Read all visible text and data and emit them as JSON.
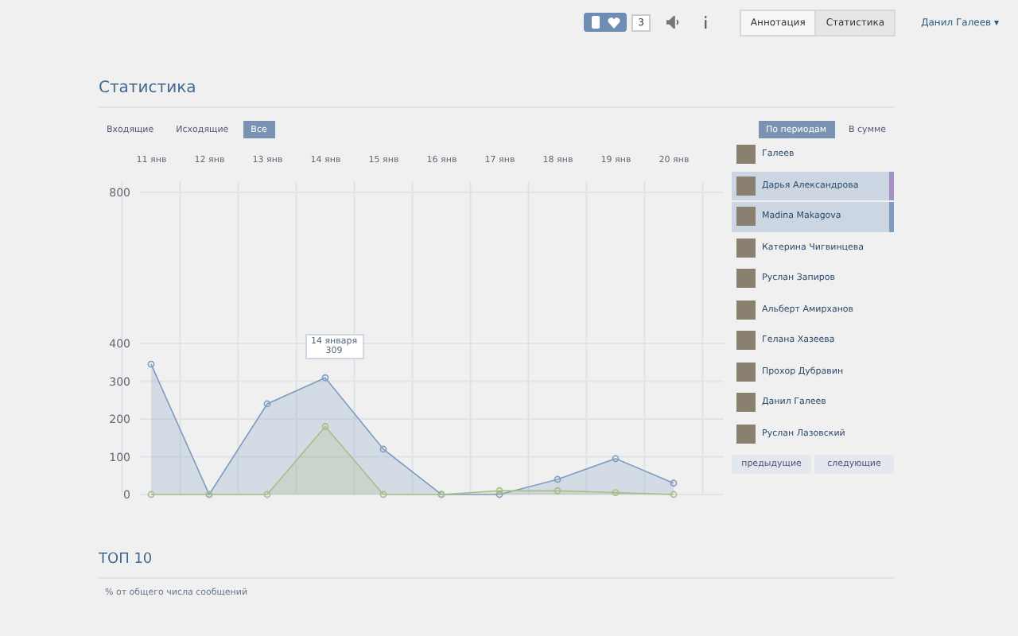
{
  "topbar": {
    "badge_count": "3",
    "tabs": [
      {
        "label": "Аннотация",
        "selected": false
      },
      {
        "label": "Статистика",
        "selected": true
      }
    ],
    "user": "Данил Галеев",
    "user_caret": "▾"
  },
  "title": "Статистика",
  "filters": [
    {
      "label": "Входящие",
      "selected": false
    },
    {
      "label": "Исходящие",
      "selected": false
    },
    {
      "label": "Все",
      "selected": true
    }
  ],
  "modes": [
    {
      "label": "По периодам",
      "selected": true
    },
    {
      "label": "В сумме",
      "selected": false
    }
  ],
  "chart_data": {
    "type": "area",
    "categories": [
      "11 янв",
      "12 янв",
      "13 янв",
      "14 янв",
      "15 янв",
      "16 янв",
      "17 янв",
      "18 янв",
      "19 янв",
      "20 янв"
    ],
    "ylim": [
      0,
      800
    ],
    "yticks": [
      0,
      100,
      200,
      300,
      400,
      800
    ],
    "grid": true,
    "series": [
      {
        "color": "#7d9cc0",
        "values": [
          345,
          0,
          240,
          309,
          120,
          0,
          0,
          40,
          95,
          30
        ]
      },
      {
        "color": "#a7be85",
        "values": [
          0,
          0,
          0,
          180,
          0,
          0,
          10,
          10,
          5,
          0
        ]
      }
    ]
  },
  "tooltip": {
    "date": "14 января",
    "value": "309"
  },
  "people": [
    {
      "name": "Галеев",
      "selected": false
    },
    {
      "name": "Дарья Александрова",
      "selected": true,
      "color": "#a58fc4"
    },
    {
      "name": "Madina Makagova",
      "selected": true,
      "color": "#7d9cc0"
    },
    {
      "name": "Катерина Чигвинцева",
      "selected": false
    },
    {
      "name": "Руслан Запиров",
      "selected": false
    },
    {
      "name": "Альберт Амирханов",
      "selected": false
    },
    {
      "name": "Гелана Хазеева",
      "selected": false
    },
    {
      "name": "Прохор Дубравин",
      "selected": false
    },
    {
      "name": "Данил Галеев",
      "selected": false
    },
    {
      "name": "Руслан Лазовский",
      "selected": false
    }
  ],
  "pager": [
    "предыдущие",
    "следующие"
  ],
  "top": {
    "title": "ТОП 10",
    "subtitle": "% от общего числа сообщений"
  }
}
